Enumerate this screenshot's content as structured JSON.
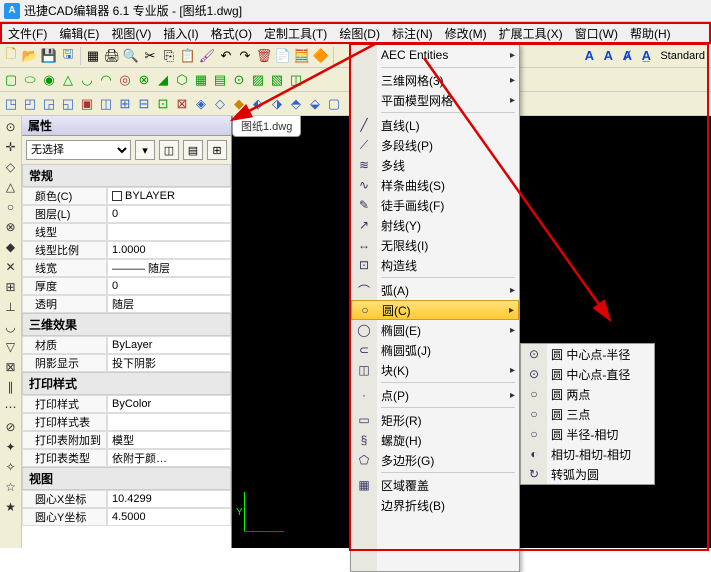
{
  "title": "迅捷CAD编辑器 6.1 专业版 - [图纸1.dwg]",
  "menu": [
    "文件(F)",
    "编辑(E)",
    "视图(V)",
    "插入(I)",
    "格式(O)",
    "定制工具(T)",
    "绘图(D)",
    "标注(N)",
    "修改(M)",
    "扩展工具(X)",
    "窗口(W)",
    "帮助(H)"
  ],
  "tb3_text": "Standard",
  "doc_tab": "图纸1.dwg",
  "prop": {
    "title": "属性",
    "noselect": "无选择",
    "groups": {
      "general": "常规",
      "g1": [
        [
          "颜色(C)",
          "BYLAYER"
        ],
        [
          "图层(L)",
          "0"
        ],
        [
          "线型",
          ""
        ],
        [
          "线型比例",
          "1.0000"
        ],
        [
          "线宽",
          "——— 随层"
        ],
        [
          "厚度",
          "0"
        ],
        [
          "透明",
          "随层"
        ]
      ],
      "threed": "三维效果",
      "g2": [
        [
          "材质",
          "ByLayer"
        ],
        [
          "阴影显示",
          "投下阴影"
        ]
      ],
      "print": "打印样式",
      "g3": [
        [
          "打印样式",
          "ByColor"
        ],
        [
          "打印样式表",
          ""
        ],
        [
          "打印表附加到",
          "模型"
        ],
        [
          "打印表类型",
          "依附于颜…"
        ]
      ],
      "view": "视图",
      "g4": [
        [
          "圆心X坐标",
          "10.4299"
        ],
        [
          "圆心Y坐标",
          "4.5000"
        ]
      ]
    }
  },
  "draw_menu": {
    "top": [
      "AEC Entities"
    ],
    "sec1": [
      "三维网格(3)",
      "平面模型网格"
    ],
    "sec2_items": [
      {
        "icon": "╱",
        "label": "直线(L)"
      },
      {
        "icon": "⟋",
        "label": "多段线(P)"
      },
      {
        "icon": "≋",
        "label": "多线"
      },
      {
        "icon": "∿",
        "label": "样条曲线(S)"
      },
      {
        "icon": "✎",
        "label": "徒手画线(F)"
      },
      {
        "icon": "↗",
        "label": "射线(Y)"
      },
      {
        "icon": "↔",
        "label": "无限线(I)"
      },
      {
        "icon": "⊡",
        "label": "构造线"
      }
    ],
    "sec3_items": [
      {
        "icon": "⌒",
        "label": "弧(A)",
        "sub": true
      },
      {
        "icon": "○",
        "label": "圆(C)",
        "sub": true,
        "hl": true
      },
      {
        "icon": "◯",
        "label": "椭圆(E)",
        "sub": true
      },
      {
        "icon": "⊂",
        "label": "椭圆弧(J)"
      },
      {
        "icon": "◫",
        "label": "块(K)",
        "sub": true
      }
    ],
    "sec4_items": [
      {
        "icon": "·",
        "label": "点(P)",
        "sub": true
      }
    ],
    "sec5_items": [
      {
        "icon": "▭",
        "label": "矩形(R)"
      },
      {
        "icon": "§",
        "label": "螺旋(H)"
      },
      {
        "icon": "⬠",
        "label": "多边形(G)"
      }
    ],
    "sec6_items": [
      {
        "icon": "▦",
        "label": "区域覆盖"
      },
      {
        "icon": "",
        "label": "边界折线(B)"
      }
    ]
  },
  "circle_submenu": [
    {
      "icon": "⊙",
      "label": "圆 中心点-半径"
    },
    {
      "icon": "⊙",
      "label": "圆 中心点-直径"
    },
    {
      "icon": "○",
      "label": "圆 两点"
    },
    {
      "icon": "○",
      "label": "圆 三点"
    },
    {
      "icon": "○",
      "label": "圆 半径-相切"
    },
    {
      "icon": "◐",
      "label": "相切-相切-相切"
    },
    {
      "icon": "↻",
      "label": "转弧为圆"
    }
  ],
  "axis": {
    "y": "Y"
  }
}
